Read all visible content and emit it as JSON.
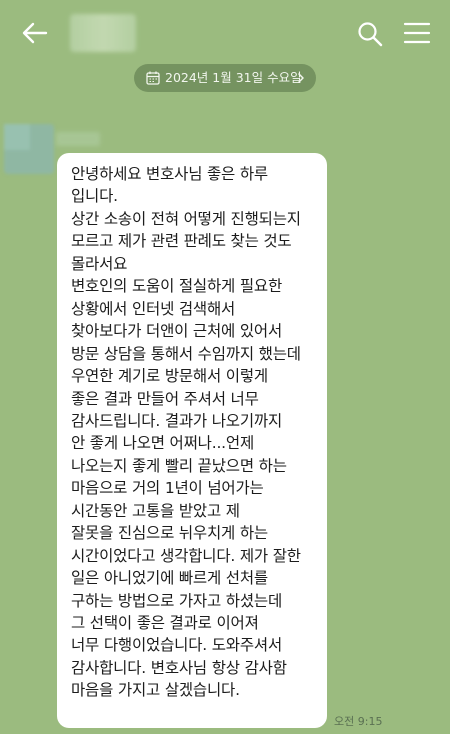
{
  "topbar": {
    "back_icon": "arrow-left-icon",
    "search_icon": "search-icon",
    "menu_icon": "hamburger-menu-icon"
  },
  "date_divider": {
    "icon": "calendar-icon",
    "text": "2024년 1월 31일 수요일",
    "chevron": "chevron-right-icon"
  },
  "message": {
    "lines": [
      "안녕하세요 변호사님 좋은 하루",
      "입니다.",
      "상간 소송이 전혀 어떻게 진행되는지",
      "모르고 제가 관련 판례도 찾는 것도",
      "몰라서요",
      "변호인의 도움이 절실하게 필요한",
      "상황에서 인터넷 검색해서",
      "찾아보다가 더앤이 근처에 있어서",
      "방문 상담을 통해서 수임까지 했는데",
      "우연한 계기로 방문해서 이렇게",
      "좋은 결과 만들어 주셔서 너무",
      "감사드립니다. 결과가 나오기까지",
      "안 좋게 나오면 어쩌나...언제",
      "나오는지  좋게 빨리 끝났으면 하는",
      "마음으로 거의 1년이 넘어가는",
      "시간동안 고통을 받았고 제",
      "잘못을 진심으로 뉘우치게 하는",
      "시간이었다고 생각합니다. 제가 잘한",
      "일은 아니었기에 빠르게 선처를",
      "구하는 방법으로 가자고 하셨는데",
      "그 선택이 좋은 결과로 이어져",
      "너무 다행이었습니다. 도와주셔서",
      "감사합니다. 변호사님 항상 감사함",
      "마음을 가지고 살겠습니다."
    ],
    "time": "오전 9:15"
  },
  "colors": {
    "background": "#9bbb7f",
    "bubble": "#ffffff",
    "text": "#1c1c1c"
  }
}
